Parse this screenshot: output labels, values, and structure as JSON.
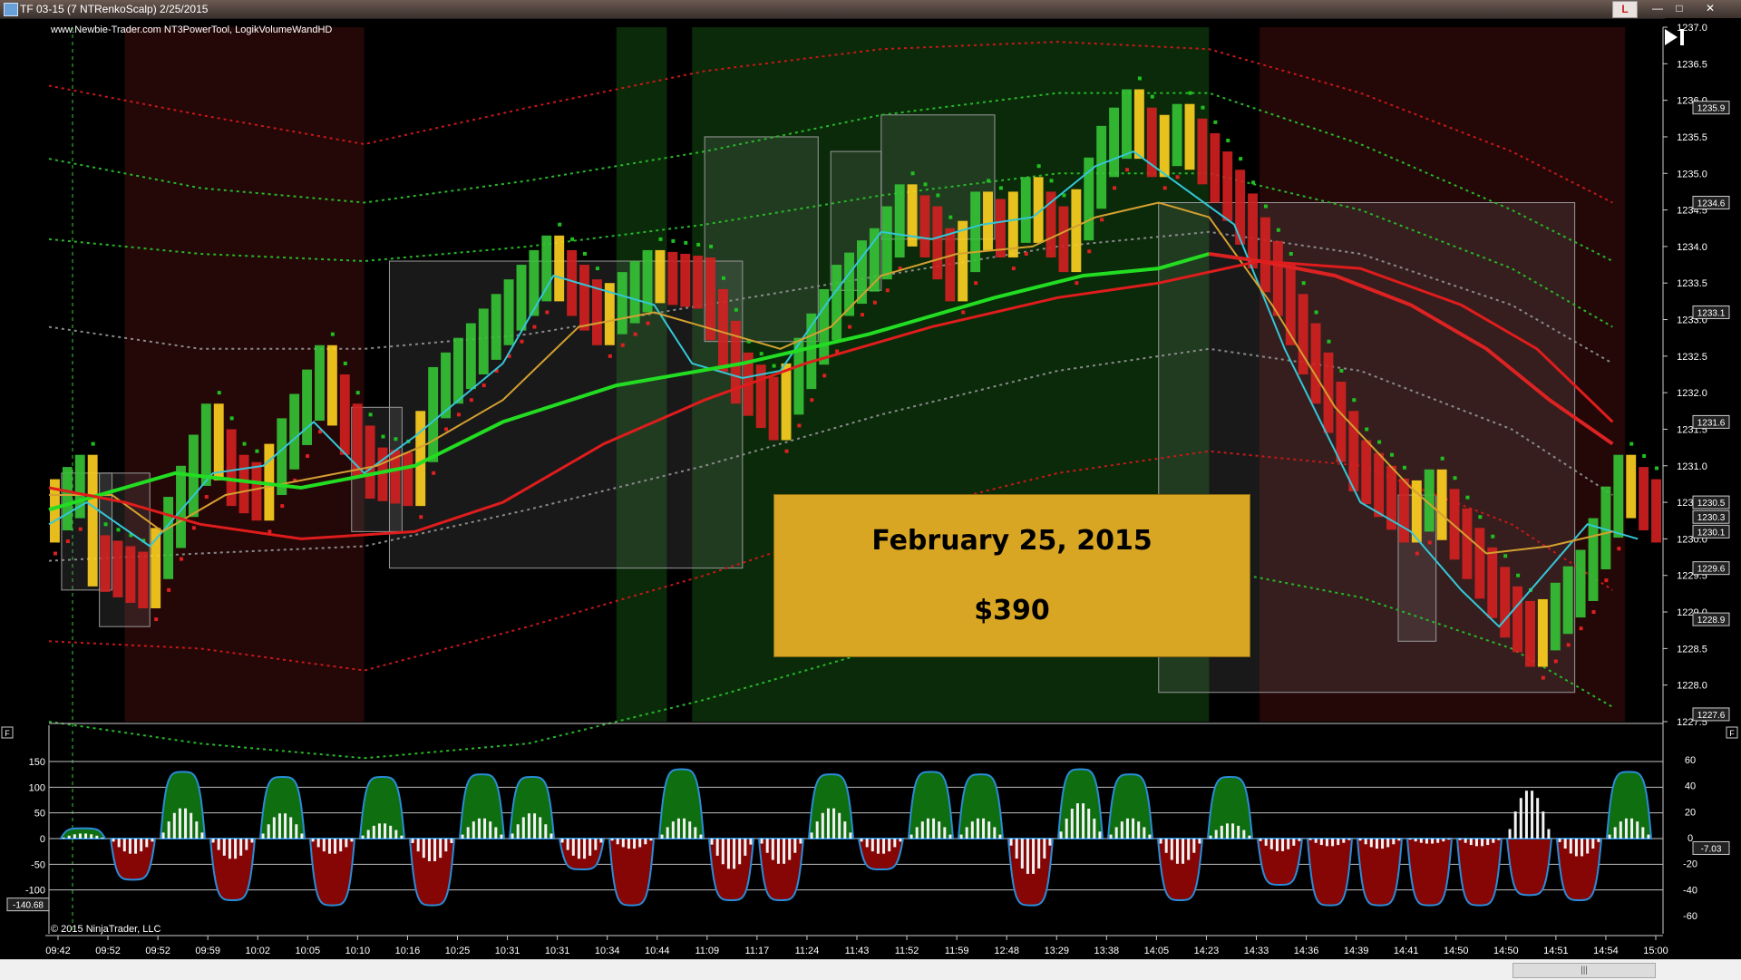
{
  "window": {
    "title": "TF 03-15 (7 NTRenkoScalp)  2/25/2015",
    "link_label": "L",
    "min_glyph": "—",
    "max_glyph": "□",
    "close_glyph": "✕"
  },
  "indicators_label": "www.Newbie-Trader.com NT3PowerTool, LogikVolumeWandHD",
  "copyright": "© 2015 NinjaTrader, LLC",
  "annotation": {
    "date": "February 25, 2015",
    "value": "$390"
  },
  "scroll_glyph": "|||",
  "panel_button_label": "F",
  "colors": {
    "background": "#000000",
    "green_zone": "#0a2a0a",
    "red_zone": "#240707",
    "bull_bar": "#35c435",
    "bear_bar": "#d42020",
    "transition_bar": "#ffd21f",
    "fast_line": "#34c7d8",
    "slow_line": "#d4a030",
    "trend_line_green": "#22dd22",
    "trend_line_red": "#dd2222",
    "annotation_bg": "#d9a624",
    "osc_green_fill": "#0f6e0f",
    "osc_red_fill": "#860505"
  },
  "chart_data": [
    {
      "type": "renko_price",
      "x_tick_labels": [
        "09:42",
        "09:52",
        "09:52",
        "09:59",
        "10:02",
        "10:05",
        "10:10",
        "10:16",
        "10:25",
        "10:31",
        "10:31",
        "10:34",
        "10:44",
        "11:09",
        "11:17",
        "11:24",
        "11:43",
        "11:52",
        "11:59",
        "12:48",
        "13:29",
        "13:38",
        "14:05",
        "14:23",
        "14:33",
        "14:36",
        "14:39",
        "14:41",
        "14:50",
        "14:50",
        "14:51",
        "14:54",
        "15:00"
      ],
      "y_axis_labels": [
        "1237.0",
        "1236.5",
        "1236.0",
        "1235.5",
        "1235.0",
        "1234.5",
        "1234.0",
        "1233.5",
        "1233.0",
        "1232.5",
        "1232.0",
        "1231.5",
        "1231.0",
        "1230.5",
        "1230.0",
        "1229.5",
        "1229.0",
        "1228.5",
        "1228.0",
        "1227.5"
      ],
      "ylim": [
        1227.5,
        1237.0
      ],
      "price_markers": [
        "1235.9",
        "1234.6",
        "1233.1",
        "1231.6",
        "1230.5",
        "1230.3",
        "1230.1",
        "1229.6",
        "1228.9",
        "1227.6"
      ],
      "price_path": [
        [
          0,
          1230.3
        ],
        [
          3,
          1230.8
        ],
        [
          4,
          1229.7
        ],
        [
          8,
          1229.4
        ],
        [
          9,
          1229.8
        ],
        [
          13,
          1231.5
        ],
        [
          15,
          1230.8
        ],
        [
          17,
          1230.6
        ],
        [
          19,
          1231.3
        ],
        [
          22,
          1232.3
        ],
        [
          24,
          1231.5
        ],
        [
          26,
          1230.9
        ],
        [
          29,
          1230.8
        ],
        [
          31,
          1232.0
        ],
        [
          40,
          1233.8
        ],
        [
          44,
          1233.0
        ],
        [
          48,
          1233.6
        ],
        [
          52,
          1233.5
        ],
        [
          55,
          1232.2
        ],
        [
          58,
          1231.7
        ],
        [
          60,
          1232.4
        ],
        [
          63,
          1233.4
        ],
        [
          66,
          1233.9
        ],
        [
          68,
          1234.5
        ],
        [
          70,
          1234.2
        ],
        [
          72,
          1233.6
        ],
        [
          74,
          1234.4
        ],
        [
          76,
          1234.2
        ],
        [
          78,
          1234.6
        ],
        [
          81,
          1234.0
        ],
        [
          84,
          1235.3
        ],
        [
          86,
          1235.8
        ],
        [
          88,
          1235.3
        ],
        [
          90,
          1235.6
        ],
        [
          92,
          1235.2
        ],
        [
          94,
          1234.7
        ],
        [
          98,
          1233.4
        ],
        [
          104,
          1231.0
        ],
        [
          108,
          1230.3
        ],
        [
          110,
          1230.6
        ],
        [
          116,
          1229.0
        ],
        [
          118,
          1228.6
        ],
        [
          122,
          1229.5
        ],
        [
          125,
          1230.8
        ],
        [
          128,
          1230.3
        ]
      ],
      "green_zones": [
        [
          45,
          49
        ],
        [
          51,
          92
        ]
      ],
      "red_zones": [
        [
          6,
          25
        ],
        [
          96,
          125
        ]
      ],
      "boxes": [
        [
          1,
          1230.9,
          1229.3
        ],
        [
          4,
          1230.9,
          1228.8
        ],
        [
          24,
          1231.8,
          1230.1
        ],
        [
          27,
          1233.8,
          1229.6
        ],
        [
          52,
          1235.5,
          1232.7
        ],
        [
          62,
          1235.3,
          1233.4
        ],
        [
          66,
          1235.8,
          1234.1
        ],
        [
          88,
          1234.6,
          1227.9
        ],
        [
          107,
          1230.6,
          1228.6
        ]
      ],
      "series": [
        {
          "name": "fast",
          "color": "#34c7d8",
          "values": [
            [
              0,
              1230.2
            ],
            [
              3,
              1230.5
            ],
            [
              8,
              1229.9
            ],
            [
              13,
              1230.9
            ],
            [
              17,
              1231.0
            ],
            [
              21,
              1231.6
            ],
            [
              25,
              1230.9
            ],
            [
              29,
              1231.4
            ],
            [
              36,
              1232.4
            ],
            [
              40,
              1233.6
            ],
            [
              44,
              1233.4
            ],
            [
              48,
              1233.2
            ],
            [
              51,
              1232.4
            ],
            [
              55,
              1232.2
            ],
            [
              58,
              1232.3
            ],
            [
              62,
              1233.3
            ],
            [
              66,
              1234.2
            ],
            [
              70,
              1234.1
            ],
            [
              74,
              1234.3
            ],
            [
              78,
              1234.4
            ],
            [
              83,
              1235.1
            ],
            [
              86,
              1235.3
            ],
            [
              90,
              1234.8
            ],
            [
              94,
              1234.3
            ],
            [
              98,
              1232.6
            ],
            [
              104,
              1230.5
            ],
            [
              108,
              1230.1
            ],
            [
              112,
              1229.3
            ],
            [
              115,
              1228.8
            ],
            [
              118,
              1229.4
            ],
            [
              122,
              1230.2
            ],
            [
              126,
              1230.0
            ]
          ]
        },
        {
          "name": "slow",
          "color": "#d4a030",
          "values": [
            [
              0,
              1230.6
            ],
            [
              5,
              1230.6
            ],
            [
              9,
              1230.1
            ],
            [
              14,
              1230.6
            ],
            [
              20,
              1230.8
            ],
            [
              26,
              1231.0
            ],
            [
              30,
              1231.3
            ],
            [
              36,
              1231.9
            ],
            [
              42,
              1232.9
            ],
            [
              48,
              1233.1
            ],
            [
              54,
              1232.8
            ],
            [
              58,
              1232.6
            ],
            [
              62,
              1232.9
            ],
            [
              66,
              1233.6
            ],
            [
              72,
              1233.9
            ],
            [
              78,
              1234.0
            ],
            [
              83,
              1234.4
            ],
            [
              88,
              1234.6
            ],
            [
              92,
              1234.4
            ],
            [
              97,
              1233.2
            ],
            [
              102,
              1231.8
            ],
            [
              108,
              1230.7
            ],
            [
              114,
              1229.8
            ],
            [
              119,
              1229.9
            ],
            [
              124,
              1230.1
            ]
          ]
        },
        {
          "name": "trend",
          "color": "#22dd22",
          "values": [
            [
              0,
              1230.4
            ],
            [
              10,
              1230.9
            ],
            [
              20,
              1230.7
            ],
            [
              29,
              1231.0
            ],
            [
              36,
              1231.6
            ],
            [
              45,
              1232.1
            ],
            [
              55,
              1232.4
            ],
            [
              65,
              1232.8
            ],
            [
              75,
              1233.3
            ],
            [
              82,
              1233.6
            ],
            [
              88,
              1233.7
            ],
            [
              92,
              1233.9
            ],
            [
              96,
              1233.8
            ],
            [
              102,
              1233.6
            ],
            [
              108,
              1233.2
            ],
            [
              114,
              1232.6
            ],
            [
              119,
              1231.9
            ],
            [
              124,
              1231.3
            ]
          ]
        },
        {
          "name": "upper-band-red",
          "color": "#c81818",
          "values": [
            [
              0,
              1236.2
            ],
            [
              12,
              1235.8
            ],
            [
              25,
              1235.4
            ],
            [
              38,
              1235.9
            ],
            [
              52,
              1236.4
            ],
            [
              66,
              1236.7
            ],
            [
              80,
              1236.8
            ],
            [
              92,
              1236.7
            ],
            [
              104,
              1236.1
            ],
            [
              116,
              1235.3
            ],
            [
              124,
              1234.6
            ]
          ]
        },
        {
          "name": "upper-band-green",
          "color": "#27b727",
          "values": [
            [
              0,
              1235.2
            ],
            [
              12,
              1234.8
            ],
            [
              25,
              1234.6
            ],
            [
              38,
              1234.9
            ],
            [
              52,
              1235.3
            ],
            [
              66,
              1235.8
            ],
            [
              80,
              1236.1
            ],
            [
              92,
              1236.1
            ],
            [
              104,
              1235.4
            ],
            [
              116,
              1234.5
            ],
            [
              124,
              1233.8
            ]
          ]
        },
        {
          "name": "upper-band-green-2",
          "color": "#27b727",
          "values": [
            [
              0,
              1234.1
            ],
            [
              12,
              1233.9
            ],
            [
              25,
              1233.8
            ],
            [
              38,
              1234.0
            ],
            [
              52,
              1234.3
            ],
            [
              66,
              1234.7
            ],
            [
              80,
              1235.0
            ],
            [
              92,
              1235.0
            ],
            [
              104,
              1234.5
            ],
            [
              116,
              1233.7
            ],
            [
              124,
              1232.9
            ]
          ]
        },
        {
          "name": "mid-upper-gray",
          "color": "#8a8a8a",
          "values": [
            [
              0,
              1232.9
            ],
            [
              12,
              1232.6
            ],
            [
              25,
              1232.6
            ],
            [
              38,
              1232.8
            ],
            [
              52,
              1233.2
            ],
            [
              66,
              1233.6
            ],
            [
              80,
              1234.0
            ],
            [
              92,
              1234.2
            ],
            [
              104,
              1233.9
            ],
            [
              116,
              1233.2
            ],
            [
              124,
              1232.4
            ]
          ]
        },
        {
          "name": "mid-lower-gray",
          "color": "#8a8a8a",
          "values": [
            [
              0,
              1229.7
            ],
            [
              12,
              1229.8
            ],
            [
              25,
              1229.9
            ],
            [
              38,
              1230.4
            ],
            [
              52,
              1231.0
            ],
            [
              66,
              1231.7
            ],
            [
              80,
              1232.3
            ],
            [
              92,
              1232.6
            ],
            [
              104,
              1232.3
            ],
            [
              116,
              1231.5
            ],
            [
              124,
              1230.6
            ]
          ]
        },
        {
          "name": "lower-band-red",
          "color": "#c81818",
          "values": [
            [
              0,
              1228.6
            ],
            [
              12,
              1228.5
            ],
            [
              25,
              1228.2
            ],
            [
              38,
              1228.8
            ],
            [
              52,
              1229.5
            ],
            [
              66,
              1230.3
            ],
            [
              80,
              1230.9
            ],
            [
              92,
              1231.2
            ],
            [
              104,
              1231.0
            ],
            [
              116,
              1230.2
            ],
            [
              124,
              1229.3
            ]
          ]
        },
        {
          "name": "lower-band-green",
          "color": "#27b727",
          "values": [
            [
              0,
              1227.5
            ],
            [
              12,
              1227.2
            ],
            [
              25,
              1227.0
            ],
            [
              38,
              1227.2
            ],
            [
              52,
              1227.8
            ],
            [
              66,
              1228.5
            ],
            [
              80,
              1229.2
            ],
            [
              92,
              1229.6
            ],
            [
              104,
              1229.2
            ],
            [
              116,
              1228.5
            ],
            [
              124,
              1227.7
            ]
          ]
        },
        {
          "name": "ema-long-red",
          "color": "#e01c1c",
          "values": [
            [
              0,
              1230.7
            ],
            [
              6,
              1230.5
            ],
            [
              12,
              1230.2
            ],
            [
              20,
              1230.0
            ],
            [
              29,
              1230.1
            ],
            [
              36,
              1230.5
            ],
            [
              44,
              1231.3
            ],
            [
              52,
              1231.9
            ],
            [
              60,
              1232.4
            ],
            [
              70,
              1232.9
            ],
            [
              80,
              1233.3
            ],
            [
              88,
              1233.5
            ],
            [
              96,
              1233.8
            ],
            [
              104,
              1233.7
            ],
            [
              112,
              1233.2
            ],
            [
              118,
              1232.6
            ],
            [
              124,
              1231.6
            ]
          ]
        }
      ]
    },
    {
      "type": "oscillator",
      "y_axis_labels_left": [
        "150",
        "100",
        "50",
        "0",
        "-50",
        "-100"
      ],
      "y_axis_labels_right": [
        "60",
        "40",
        "20",
        "0",
        "-20",
        "-40",
        "-60"
      ],
      "current_value_left": "-140.68",
      "current_value_right": "-7.03",
      "ylim": [
        -150,
        150
      ],
      "filled_values": [
        20,
        -80,
        130,
        -120,
        120,
        -130,
        120,
        -130,
        125,
        120,
        -60,
        -130,
        135,
        -120,
        -120,
        125,
        -60,
        130,
        125,
        -130,
        135,
        125,
        -120,
        120,
        -90,
        -130,
        -130,
        -130,
        -130,
        -110,
        -120,
        130,
        -120
      ],
      "histogram_values": [
        10,
        -30,
        60,
        -40,
        50,
        -30,
        30,
        -45,
        40,
        50,
        -40,
        -20,
        40,
        -60,
        -50,
        60,
        -30,
        40,
        40,
        -70,
        70,
        40,
        -50,
        30,
        -25,
        -15,
        -20,
        -10,
        -15,
        95,
        -35,
        40,
        -12
      ]
    }
  ]
}
